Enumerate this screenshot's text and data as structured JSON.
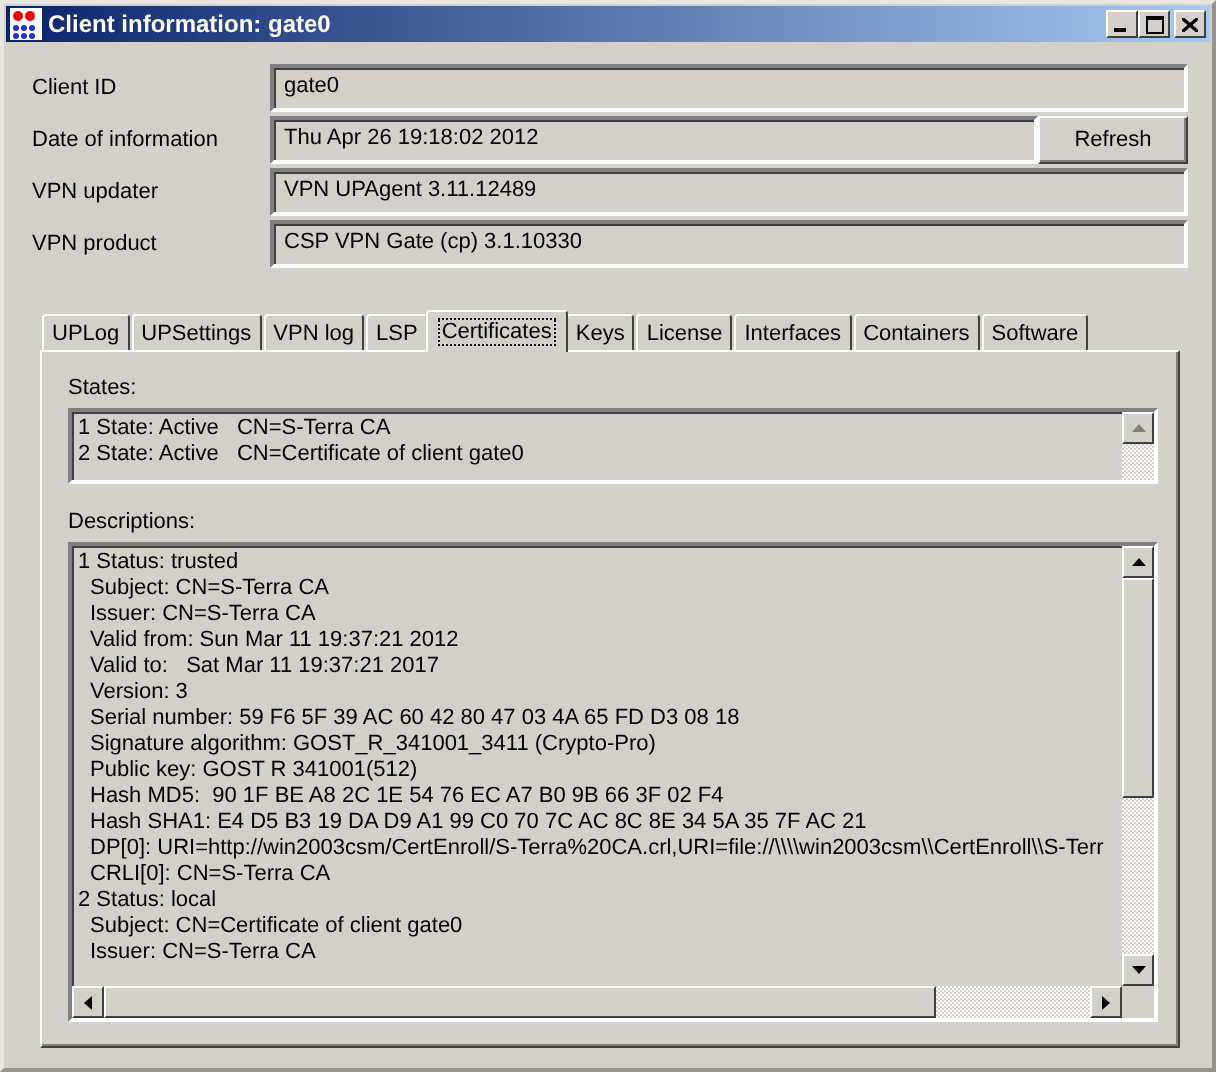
{
  "window": {
    "title": "Client information: gate0"
  },
  "fields": [
    {
      "label": "Client ID",
      "value": "gate0"
    },
    {
      "label": "Date of information",
      "value": "Thu Apr 26 19:18:02 2012",
      "button": "Refresh"
    },
    {
      "label": "VPN updater",
      "value": "VPN UPAgent 3.11.12489"
    },
    {
      "label": "VPN product",
      "value": "CSP VPN Gate (cp) 3.1.10330"
    }
  ],
  "tabs": [
    {
      "label": "UPLog",
      "selected": false
    },
    {
      "label": "UPSettings",
      "selected": false
    },
    {
      "label": "VPN log",
      "selected": false
    },
    {
      "label": "LSP",
      "selected": false
    },
    {
      "label": "Certificates",
      "selected": true
    },
    {
      "label": "Keys",
      "selected": false
    },
    {
      "label": "License",
      "selected": false
    },
    {
      "label": "Interfaces",
      "selected": false
    },
    {
      "label": "Containers",
      "selected": false
    },
    {
      "label": "Software",
      "selected": false
    }
  ],
  "states": {
    "label": "States:",
    "items": [
      "1 State: Active   CN=S-Terra CA",
      "2 State: Active   CN=Certificate of client gate0"
    ]
  },
  "descriptions": {
    "label": "Descriptions:",
    "items": [
      {
        "text": "1 Status: trusted",
        "children": [
          "Subject: CN=S-Terra CA",
          "Issuer: CN=S-Terra CA",
          "Valid from: Sun Mar 11 19:37:21 2012",
          "Valid to:   Sat Mar 11 19:37:21 2017",
          "Version: 3",
          "Serial number: 59 F6 5F 39 AC 60 42 80 47 03 4A 65 FD D3 08 18",
          "Signature algorithm: GOST_R_341001_3411 (Crypto-Pro)",
          "Public key: GOST R 341001(512)",
          "Hash MD5:  90 1F BE A8 2C 1E 54 76 EC A7 B0 9B 66 3F 02 F4",
          "Hash SHA1: E4 D5 B3 19 DA D9 A1 99 C0 70 7C AC 8C 8E 34 5A 35 7F AC 21",
          "DP[0]: URI=http://win2003csm/CertEnroll/S-Terra%20CA.crl,URI=file://\\\\\\\\win2003csm\\\\CertEnroll\\\\S-Terr",
          "CRLI[0]: CN=S-Terra CA"
        ]
      },
      {
        "text": "2 Status: local",
        "children": [
          "Subject: CN=Certificate of client gate0",
          "Issuer: CN=S-Terra CA"
        ]
      }
    ]
  }
}
